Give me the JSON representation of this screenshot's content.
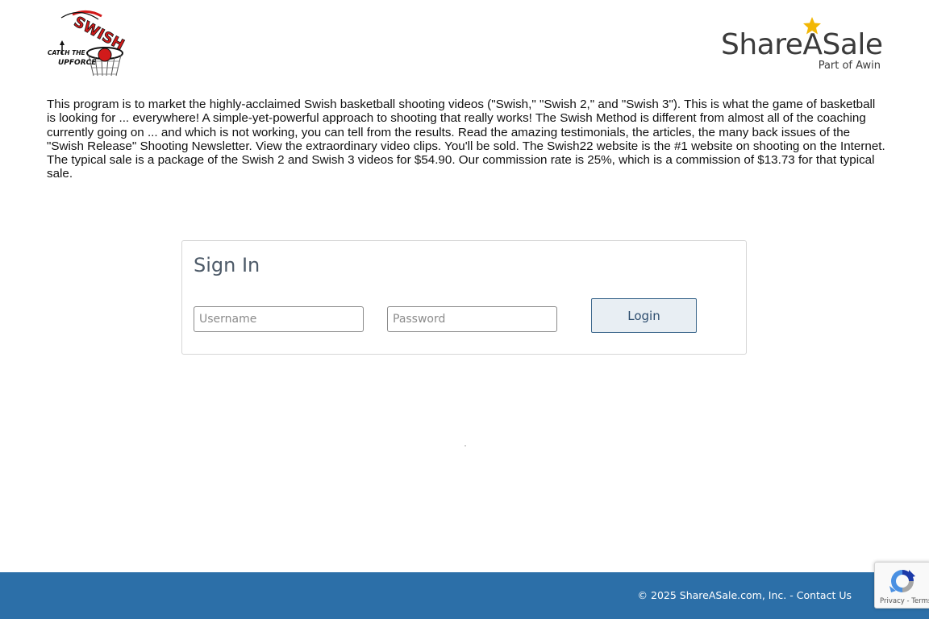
{
  "header": {
    "merchant_logo": {
      "icon": "swish-catch-the-upforce-logo",
      "top_word": "SWISH",
      "catch_text": "CATCH THE",
      "upforce_text": "UPFORCE"
    },
    "brand": {
      "name": "ShareASale",
      "tagline": "Part of Awin",
      "star_icon": "star-icon",
      "star_color": "#f2b705"
    }
  },
  "program": {
    "description": "This program is to market the highly-acclaimed Swish basketball shooting videos (\"Swish,\" \"Swish 2,\" and \"Swish 3\"). This is what the game of basketball is looking for ... everywhere! A simple-yet-powerful approach to shooting that really works! The Swish Method is different from almost all of the coaching currently going on ... and which is not working, you can tell from the results. Read the amazing testimonials, the articles, the many back issues of the \"Swish Release\" Shooting Newsletter. View the extraordinary video clips. You'll be sold. The Swish22 website is the #1 website on shooting on the Internet. The typical sale is a package of the Swish 2 and Swish 3 videos for $54.90. Our commission rate is 25%, which is a commission of $13.73 for that typical sale."
  },
  "signin": {
    "title": "Sign In",
    "username_placeholder": "Username",
    "username_value": "",
    "password_placeholder": "Password",
    "password_value": "",
    "login_label": "Login"
  },
  "footer": {
    "copyright": "© 2025 ShareASale.com, Inc. -",
    "contact_label": "Contact Us",
    "background_color": "#2c6fa8"
  },
  "recaptcha": {
    "icon": "recaptcha-icon",
    "privacy_label": "Privacy",
    "separator": " - ",
    "terms_label": "Terms"
  }
}
